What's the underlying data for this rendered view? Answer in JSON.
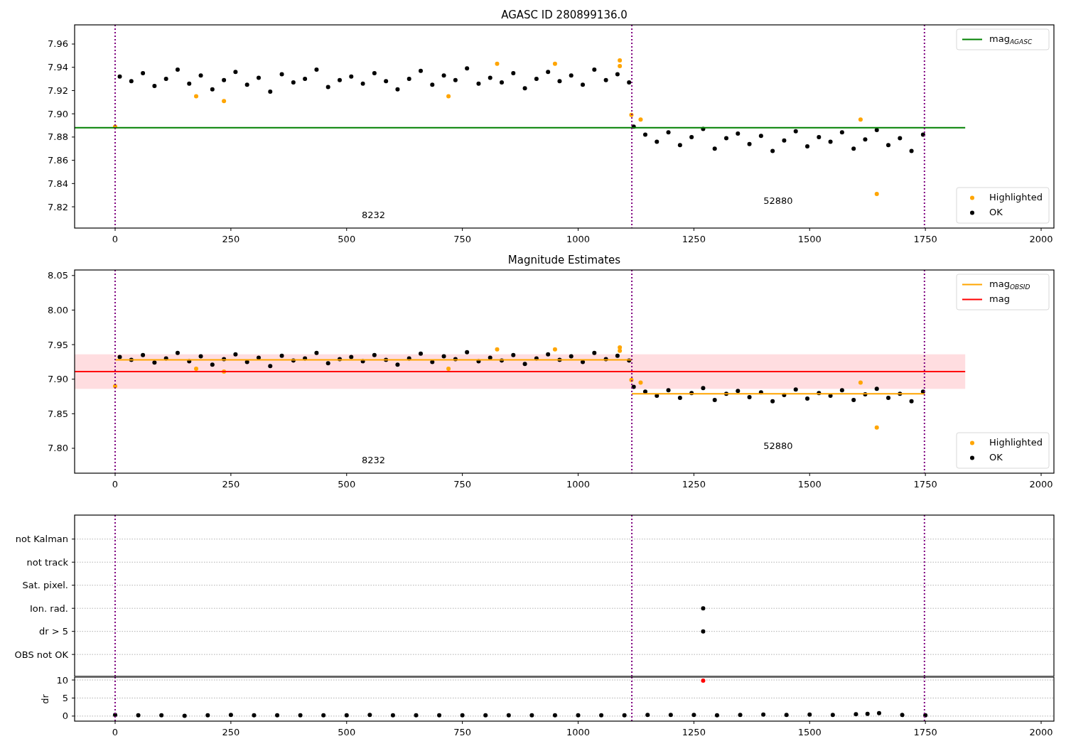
{
  "panels": [
    {
      "chart_data": {
        "type": "scatter",
        "title": "AGASC ID 280899136.0",
        "legend": "upper right",
        "xlim": [
          -87.5,
          2027.6
        ],
        "ylim": [
          7.8017,
          7.9765
        ],
        "xticks": [
          0,
          250,
          500,
          750,
          1000,
          1250,
          1500,
          1750,
          2000
        ],
        "yticks": [
          {
            "value": 7.82,
            "label": "7.82"
          },
          {
            "value": 7.84,
            "label": "7.84"
          },
          {
            "value": 7.86,
            "label": "7.86"
          },
          {
            "value": 7.88,
            "label": "7.88"
          },
          {
            "value": 7.9,
            "label": "7.90"
          },
          {
            "value": 7.92,
            "label": "7.92"
          },
          {
            "value": 7.94,
            "label": "7.94"
          },
          {
            "value": 7.96,
            "label": "7.96"
          }
        ],
        "ref_lines": [
          {
            "axis": "x",
            "value": 0,
            "color": "#800080"
          },
          {
            "axis": "x",
            "value": 1116,
            "color": "#800080"
          },
          {
            "axis": "x",
            "value": 1748,
            "color": "#800080"
          }
        ],
        "series": [
          {
            "name": "mag$_{AGASC}$",
            "type": "line",
            "color": "#008000",
            "x": [
              -87.5,
              1836
            ],
            "values": [
              7.888,
              7.888
            ]
          },
          {
            "name": "Highlighted",
            "color": "#ffa500",
            "x": [
              0,
              175,
              235,
              720,
              825,
              950,
              1090,
              1090,
              1115,
              1135,
              1610,
              1645
            ],
            "values": [
              7.889,
              7.915,
              7.911,
              7.915,
              7.943,
              7.943,
              7.946,
              7.941,
              7.899,
              7.895,
              7.895,
              7.831
            ]
          },
          {
            "name": "OK",
            "color": "#000000",
            "x": [
              10,
              35,
              60,
              85,
              110,
              135,
              160,
              185,
              210,
              235,
              260,
              285,
              310,
              335,
              360,
              385,
              410,
              435,
              460,
              485,
              510,
              535,
              560,
              585,
              610,
              635,
              660,
              685,
              710,
              735,
              760,
              785,
              810,
              835,
              860,
              885,
              910,
              935,
              960,
              985,
              1010,
              1035,
              1060,
              1085,
              1110,
              1120,
              1145,
              1170,
              1195,
              1220,
              1245,
              1270,
              1295,
              1320,
              1345,
              1370,
              1395,
              1420,
              1445,
              1470,
              1495,
              1520,
              1545,
              1570,
              1595,
              1620,
              1645,
              1670,
              1695,
              1720,
              1745
            ],
            "values": [
              7.932,
              7.928,
              7.935,
              7.924,
              7.93,
              7.938,
              7.926,
              7.933,
              7.921,
              7.929,
              7.936,
              7.925,
              7.931,
              7.919,
              7.934,
              7.927,
              7.93,
              7.938,
              7.923,
              7.929,
              7.932,
              7.926,
              7.935,
              7.928,
              7.921,
              7.93,
              7.937,
              7.925,
              7.933,
              7.929,
              7.939,
              7.926,
              7.931,
              7.927,
              7.935,
              7.922,
              7.93,
              7.936,
              7.928,
              7.933,
              7.925,
              7.938,
              7.929,
              7.934,
              7.927,
              7.889,
              7.882,
              7.876,
              7.884,
              7.873,
              7.88,
              7.887,
              7.87,
              7.879,
              7.883,
              7.874,
              7.881,
              7.868,
              7.877,
              7.885,
              7.872,
              7.88,
              7.876,
              7.884,
              7.87,
              7.878,
              7.886,
              7.873,
              7.879,
              7.868,
              7.882
            ]
          }
        ],
        "annotations": [
          "8232",
          "52880"
        ]
      }
    },
    {
      "chart_data": {
        "type": "scatter",
        "title": "Magnitude Estimates",
        "legend": "upper right",
        "xlim": [
          -87.5,
          2027.6
        ],
        "ylim": [
          7.764,
          8.058
        ],
        "xticks": [
          0,
          250,
          500,
          750,
          1000,
          1250,
          1500,
          1750,
          2000
        ],
        "yticks": [
          {
            "value": 7.8,
            "label": "7.80"
          },
          {
            "value": 7.85,
            "label": "7.85"
          },
          {
            "value": 7.9,
            "label": "7.90"
          },
          {
            "value": 7.95,
            "label": "7.95"
          },
          {
            "value": 8.0,
            "label": "8.00"
          },
          {
            "value": 8.05,
            "label": "8.05"
          }
        ],
        "ref_lines": [
          {
            "axis": "x",
            "value": 0,
            "color": "#800080"
          },
          {
            "axis": "x",
            "value": 1116,
            "color": "#800080"
          },
          {
            "axis": "x",
            "value": 1748,
            "color": "#800080"
          }
        ],
        "bands": [
          {
            "axis": "y",
            "from": 7.886,
            "to": 7.936,
            "color": "#ffdde0"
          }
        ],
        "series": [
          {
            "name": "Highlighted",
            "color": "#ffa500",
            "x": [
              0,
              175,
              235,
              720,
              825,
              950,
              1090,
              1090,
              1115,
              1135,
              1610,
              1645
            ],
            "values": [
              7.89,
              7.915,
              7.911,
              7.915,
              7.943,
              7.943,
              7.946,
              7.941,
              7.899,
              7.895,
              7.895,
              7.83
            ]
          },
          {
            "name": "OK",
            "color": "#000000",
            "x": [
              10,
              35,
              60,
              85,
              110,
              135,
              160,
              185,
              210,
              235,
              260,
              285,
              310,
              335,
              360,
              385,
              410,
              435,
              460,
              485,
              510,
              535,
              560,
              585,
              610,
              635,
              660,
              685,
              710,
              735,
              760,
              785,
              810,
              835,
              860,
              885,
              910,
              935,
              960,
              985,
              1010,
              1035,
              1060,
              1085,
              1110,
              1120,
              1145,
              1170,
              1195,
              1220,
              1245,
              1270,
              1295,
              1320,
              1345,
              1370,
              1395,
              1420,
              1445,
              1470,
              1495,
              1520,
              1545,
              1570,
              1595,
              1620,
              1645,
              1670,
              1695,
              1720,
              1745
            ],
            "values": [
              7.932,
              7.928,
              7.935,
              7.924,
              7.93,
              7.938,
              7.926,
              7.933,
              7.921,
              7.929,
              7.936,
              7.925,
              7.931,
              7.919,
              7.934,
              7.927,
              7.93,
              7.938,
              7.923,
              7.929,
              7.932,
              7.926,
              7.935,
              7.928,
              7.921,
              7.93,
              7.937,
              7.925,
              7.933,
              7.929,
              7.939,
              7.926,
              7.931,
              7.927,
              7.935,
              7.922,
              7.93,
              7.936,
              7.928,
              7.933,
              7.925,
              7.938,
              7.929,
              7.934,
              7.927,
              7.889,
              7.882,
              7.876,
              7.884,
              7.873,
              7.88,
              7.887,
              7.87,
              7.879,
              7.883,
              7.874,
              7.881,
              7.868,
              7.877,
              7.885,
              7.872,
              7.88,
              7.876,
              7.884,
              7.87,
              7.878,
              7.886,
              7.873,
              7.879,
              7.868,
              7.882
            ]
          },
          {
            "name": "mag$_{OBSID}$",
            "type": "line",
            "color": "#ffa500",
            "x": [
              0,
              1116,
              null,
              1116,
              1748
            ],
            "values": [
              7.928,
              7.928,
              null,
              7.879,
              7.879
            ]
          },
          {
            "name": "mag",
            "type": "line",
            "color": "#ff0000",
            "x": [
              -87.5,
              1836
            ],
            "values": [
              7.911,
              7.911
            ]
          }
        ],
        "annotations": [
          "8232",
          "52880"
        ]
      }
    },
    {
      "chart_data": {
        "type": "scatter",
        "orientation": "horizontal",
        "xlim": [
          -87.5,
          2027.6
        ],
        "grid": true,
        "categories": [
          "not Kalman",
          "not track",
          "Sat. pixel.",
          "Ion. rad.",
          "dr > 5",
          "OBS not OK"
        ],
        "ref_lines": [
          {
            "axis": "x",
            "value": 0,
            "color": "#800080"
          },
          {
            "axis": "x",
            "value": 1116,
            "color": "#800080"
          },
          {
            "axis": "x",
            "value": 1748,
            "color": "#800080"
          }
        ],
        "series": [
          {
            "color": "#000000",
            "values": [
              null,
              null,
              null,
              1270,
              1270,
              null
            ]
          }
        ]
      }
    },
    {
      "chart_data": {
        "type": "scatter",
        "ylabel": "dr",
        "xlim": [
          -87.5,
          2027.6
        ],
        "ylim": [
          -1.4,
          10.8
        ],
        "grid": true,
        "xticks": [
          0,
          250,
          500,
          750,
          1000,
          1250,
          1500,
          1750,
          2000
        ],
        "yticks": [
          0,
          5,
          10
        ],
        "ref_lines": [
          {
            "axis": "x",
            "value": 0,
            "color": "#800080"
          },
          {
            "axis": "x",
            "value": 1116,
            "color": "#800080"
          },
          {
            "axis": "x",
            "value": 1748,
            "color": "#800080"
          }
        ],
        "series": [
          {
            "color": "#000000",
            "x": [
              0,
              50,
              100,
              150,
              200,
              250,
              300,
              350,
              400,
              450,
              500,
              550,
              600,
              650,
              700,
              750,
              800,
              850,
              900,
              950,
              1000,
              1050,
              1100,
              1150,
              1200,
              1250,
              1300,
              1350,
              1400,
              1450,
              1500,
              1550,
              1600,
              1625,
              1650,
              1700,
              1750
            ],
            "values": [
              0.3,
              0.2,
              0.2,
              0.1,
              0.2,
              0.3,
              0.2,
              0.2,
              0.2,
              0.2,
              0.2,
              0.3,
              0.2,
              0.2,
              0.2,
              0.2,
              0.2,
              0.2,
              0.2,
              0.2,
              0.2,
              0.2,
              0.2,
              0.3,
              0.3,
              0.3,
              0.2,
              0.3,
              0.4,
              0.3,
              0.4,
              0.3,
              0.5,
              0.6,
              0.8,
              0.3,
              0.2
            ]
          },
          {
            "color": "#ff0000",
            "x": [
              1270
            ],
            "values": [
              9.8
            ]
          }
        ]
      }
    }
  ]
}
